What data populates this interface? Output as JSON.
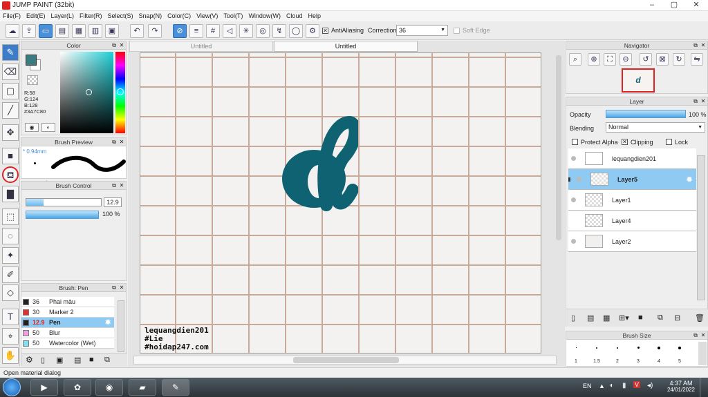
{
  "app": {
    "title": "JUMP PAINT (32bit)"
  },
  "menu": [
    "File(F)",
    "Edit(E)",
    "Layer(L)",
    "Filter(R)",
    "Select(S)",
    "Snap(N)",
    "Color(C)",
    "View(V)",
    "Tool(T)",
    "Window(W)",
    "Cloud",
    "Help"
  ],
  "toolbar": {
    "antialiasing_label": "AntiAliasing",
    "correction_label": "Correction",
    "correction_value": "36",
    "soft_edge_label": "Soft Edge"
  },
  "tabs": [
    "Untitled",
    "Untitled"
  ],
  "color_panel": {
    "title": "Color",
    "r": "R:58",
    "g": "G:124",
    "b": "B:128",
    "hex": "#3A7C80"
  },
  "brush_preview": {
    "title": "Brush Preview",
    "size": "* 0.94mm"
  },
  "brush_control": {
    "title": "Brush Control",
    "size_value": "12.9",
    "opacity_value": "100 %"
  },
  "brush_list": {
    "title": "Brush: Pen",
    "items": [
      {
        "size": "36",
        "name": "Phai màu",
        "color": "#222222"
      },
      {
        "size": "30",
        "name": "Marker 2",
        "color": "#e03030"
      },
      {
        "size": "12.9",
        "name": "Pen",
        "color": "#222222"
      },
      {
        "size": "50",
        "name": "Blur",
        "color": "#f2a0e0"
      },
      {
        "size": "50",
        "name": "Watercolor (Wet)",
        "color": "#80e0f0"
      }
    ]
  },
  "canvas": {
    "watermark_lines": [
      "lequangdien201",
      "#Lie",
      "#hoidap247.com"
    ],
    "glyph": "d",
    "glyph_color": "#0e6272"
  },
  "navigator": {
    "title": "Navigator"
  },
  "layer_panel": {
    "title": "Layer",
    "opacity_label": "Opacity",
    "opacity_value": "100 %",
    "blending_label": "Blending",
    "blending_value": "Normal",
    "protect_alpha": "Protect Alpha",
    "clipping": "Clipping",
    "lock": "Lock",
    "layers": [
      "lequangdien201",
      "Layer5",
      "Layer1",
      "Layer4",
      "Layer2"
    ]
  },
  "brush_size": {
    "title": "Brush Size",
    "sizes": [
      "1",
      "1.5",
      "2",
      "3",
      "4",
      "5"
    ]
  },
  "status": {
    "text": "Open material dialog"
  },
  "taskbar": {
    "lang": "EN",
    "time": "4:37 AM",
    "date": "24/01/2022"
  },
  "colors": {
    "accent": "#3d7cc9",
    "selection": "#8fcaf2",
    "ink": "#0e6272"
  }
}
